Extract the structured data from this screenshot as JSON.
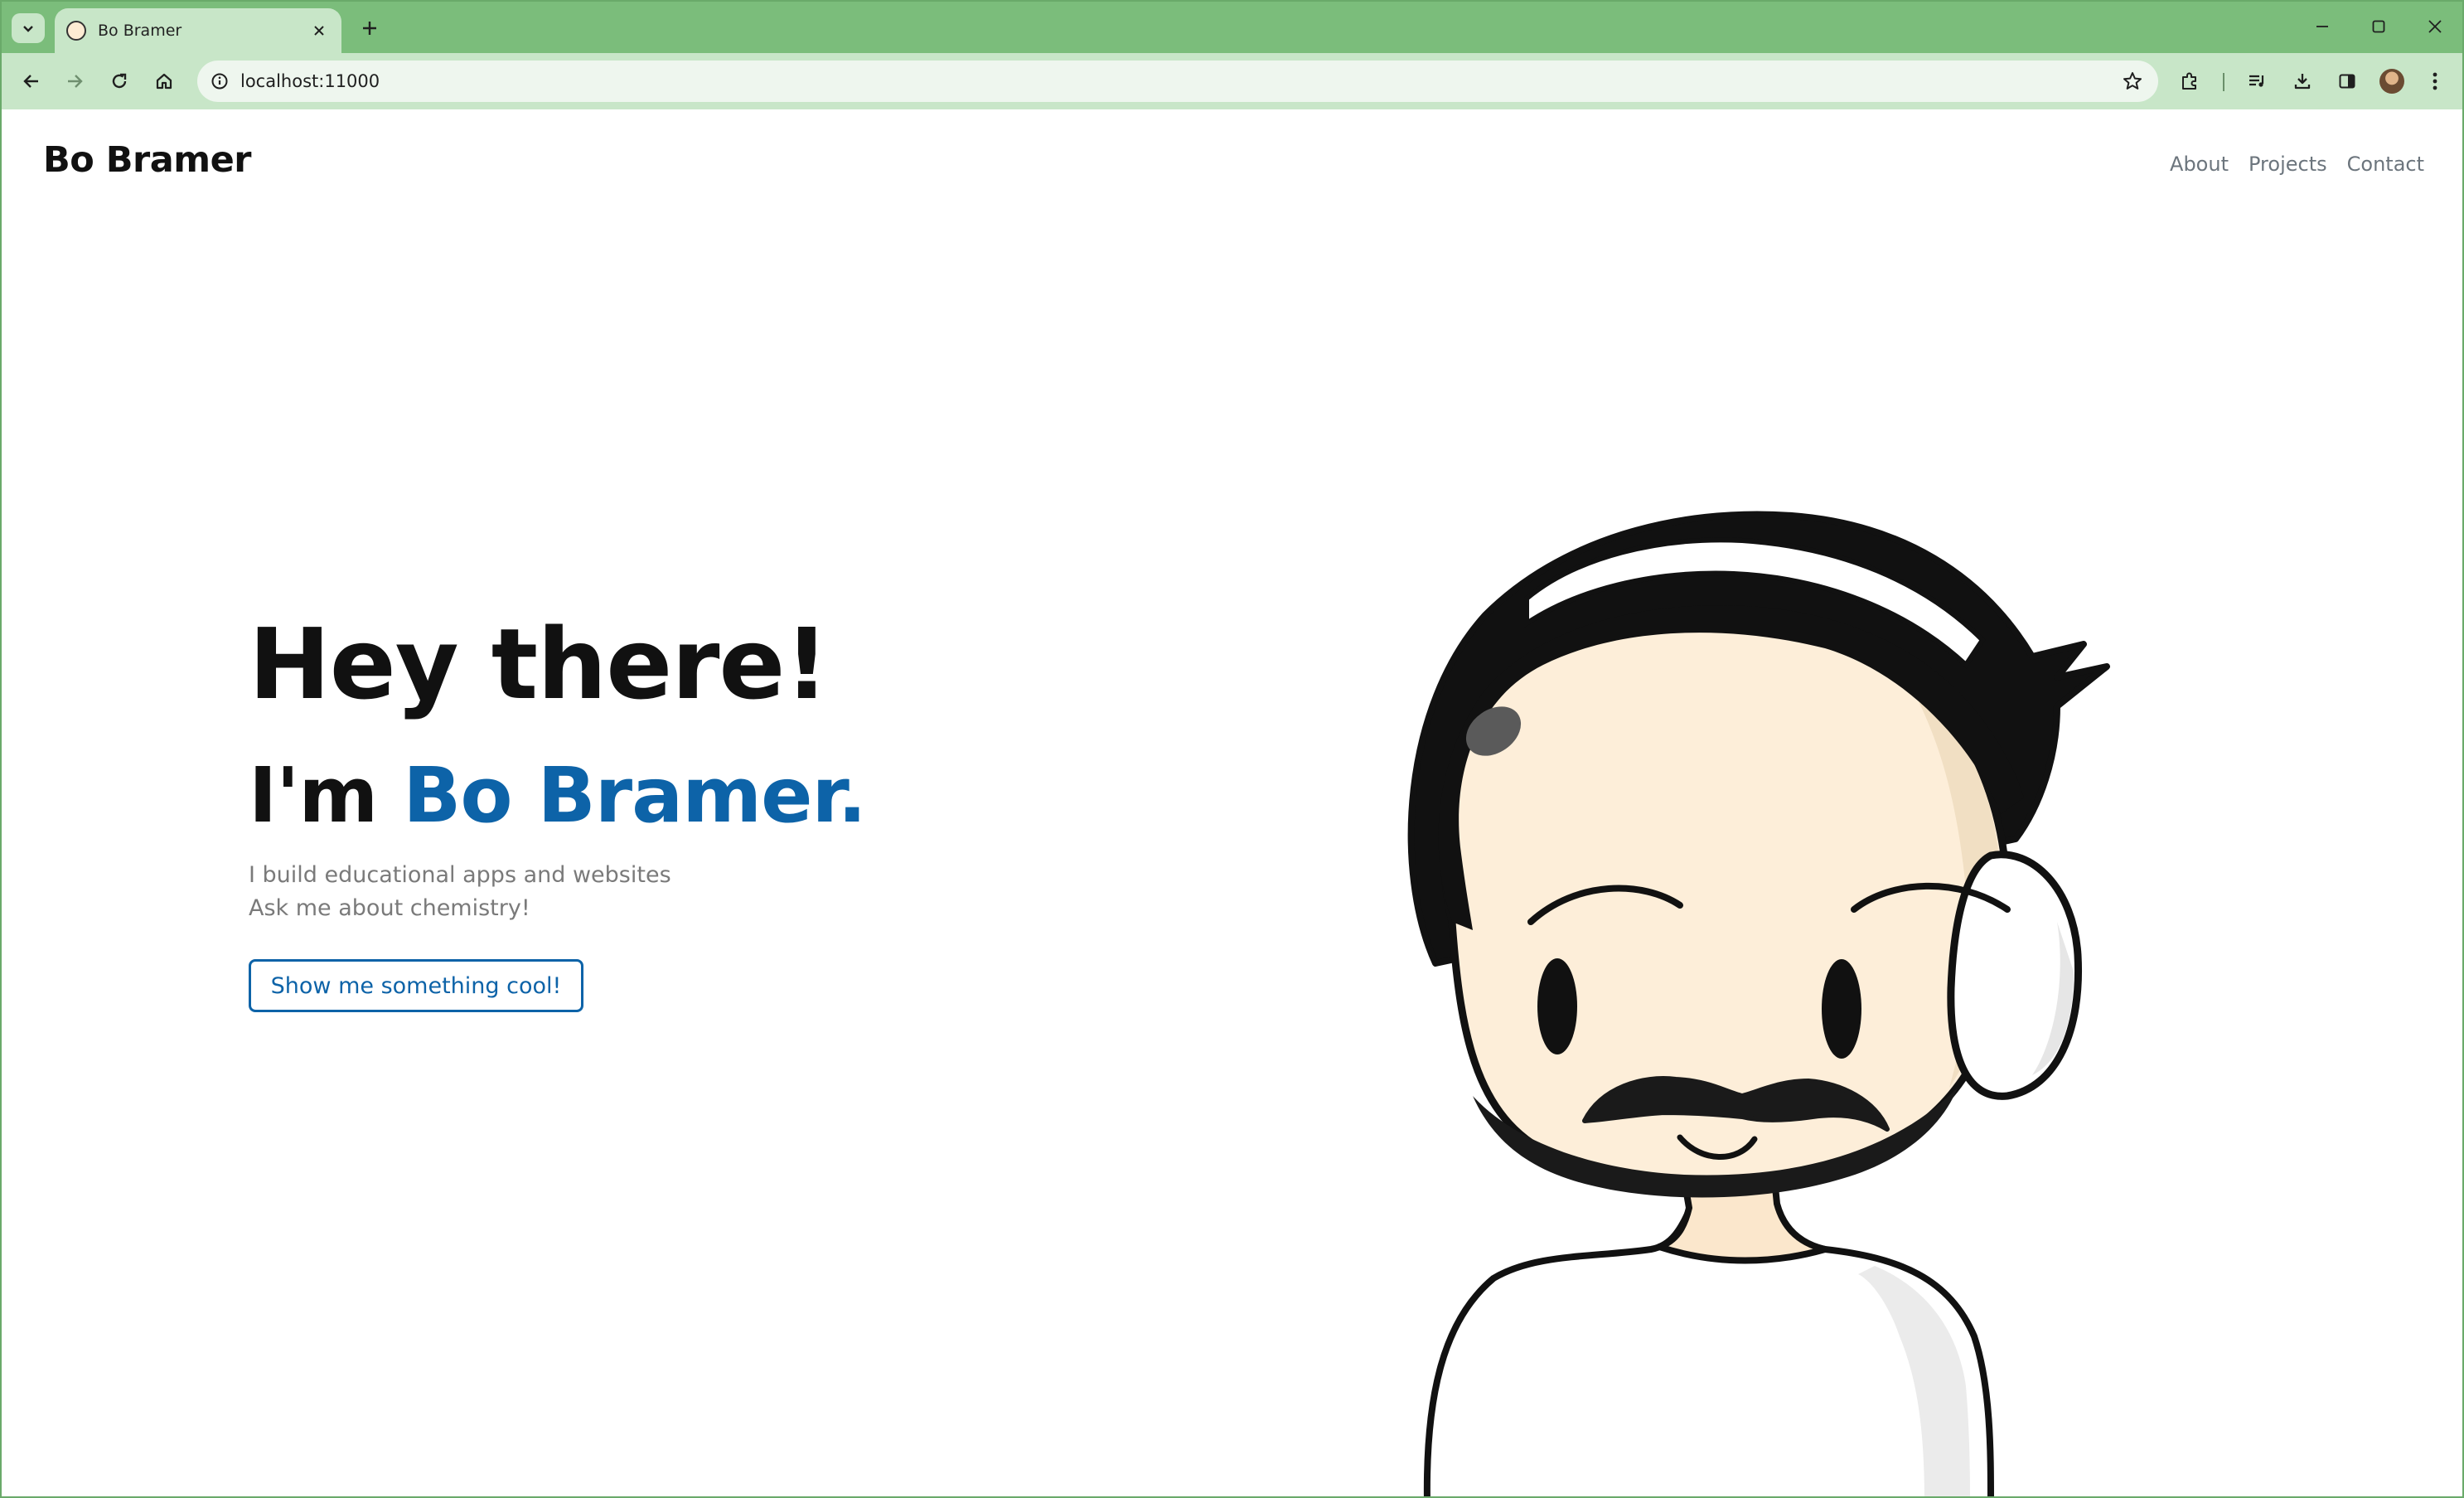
{
  "browser": {
    "tab": {
      "title": "Bo Bramer"
    },
    "address_bar": {
      "url": "localhost:11000"
    },
    "icons": [
      "tab-search-icon",
      "close-icon",
      "new-tab-icon",
      "minimize-icon",
      "maximize-icon",
      "close-window-icon",
      "back-icon",
      "forward-icon",
      "reload-icon",
      "home-icon",
      "site-info-icon",
      "bookmark-star-icon",
      "extensions-icon",
      "media-controls-icon",
      "download-icon",
      "side-panel-icon",
      "profile-avatar",
      "more-menu-icon"
    ],
    "colors": {
      "frame": "#7bbd7b",
      "toolbar": "#c8e6c8"
    }
  },
  "site": {
    "brand": "Bo Bramer",
    "nav": [
      {
        "label": "About"
      },
      {
        "label": "Projects"
      },
      {
        "label": "Contact"
      }
    ]
  },
  "hero": {
    "greeting": "Hey there!",
    "intro_prefix": "I'm ",
    "intro_name": "Bo Bramer.",
    "subtitle_line1": "I build educational apps and websites",
    "subtitle_line2": "Ask me about chemistry!",
    "cta_label": "Show me something cool!",
    "colors": {
      "accent": "#0d63a8",
      "heading": "#111111",
      "muted": "#7a7a7a"
    }
  }
}
